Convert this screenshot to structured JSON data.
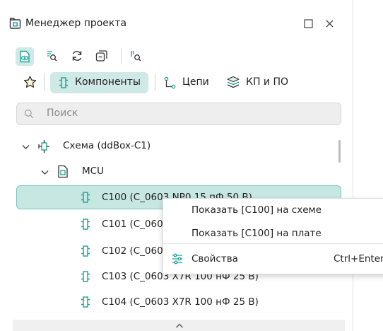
{
  "title": "Менеджер проекта",
  "tabs": {
    "components": "Компоненты",
    "nets": "Цепи",
    "pads": "КП и ПО"
  },
  "search": {
    "placeholder": "Поиск"
  },
  "tree": {
    "root": "Схема (ddBox-C1)",
    "group": "MCU",
    "items": [
      "C100 (C_0603 NP0 15 пФ 50 В)",
      "C101 (C_060",
      "C102 (C_060",
      "C103 (C_0603 X7R 100 нФ 25 В)",
      "C104 (C_0603 X7R 100 нФ 25 В)"
    ]
  },
  "context_menu": {
    "items": [
      "Показать [C100] на схеме",
      "Показать [C100] на плате"
    ],
    "properties": "Свойства",
    "properties_shortcut": "Ctrl+Enter"
  },
  "colors": {
    "accent": "#1aa394",
    "selected_bg": "#c7e7e3",
    "selected_border": "#7cc7bd"
  },
  "icons": [
    "project-icon",
    "maximize-icon",
    "close-icon",
    "show-icon",
    "find-icon",
    "refresh-icon",
    "collapse-icon",
    "find-net-icon",
    "favorite-star-icon",
    "component-icon",
    "net-icon",
    "pad-icon",
    "search-icon",
    "chevron-down-icon",
    "schematic-icon",
    "sheet-icon",
    "properties-icon",
    "chevron-up-icon"
  ]
}
